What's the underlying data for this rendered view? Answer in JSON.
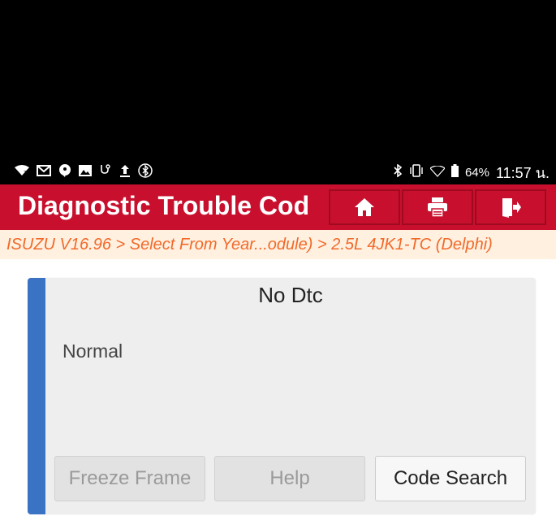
{
  "status_bar": {
    "left_icons": [
      "wifi-question-icon",
      "mail-icon",
      "chat-icon",
      "image-icon",
      "stethoscope-icon",
      "upload-icon",
      "bluetooth-box-icon"
    ],
    "right_icons": [
      "bluetooth-icon",
      "vibrate-icon",
      "signal-icon",
      "battery-icon"
    ],
    "battery": "64%",
    "time": "11:57 น."
  },
  "header": {
    "title": "Diagnostic Trouble Cod",
    "color": "#c8102e",
    "buttons": [
      "home-icon",
      "print-icon",
      "exit-icon"
    ]
  },
  "breadcrumb": "ISUZU V16.96 > Select From Year...odule) > 2.5L 4JK1-TC (Delphi)",
  "card": {
    "title": "No Dtc",
    "status": "Normal",
    "accent": "#3a72c4",
    "buttons": {
      "freeze_frame": "Freeze Frame",
      "help": "Help",
      "code_search": "Code Search"
    }
  }
}
